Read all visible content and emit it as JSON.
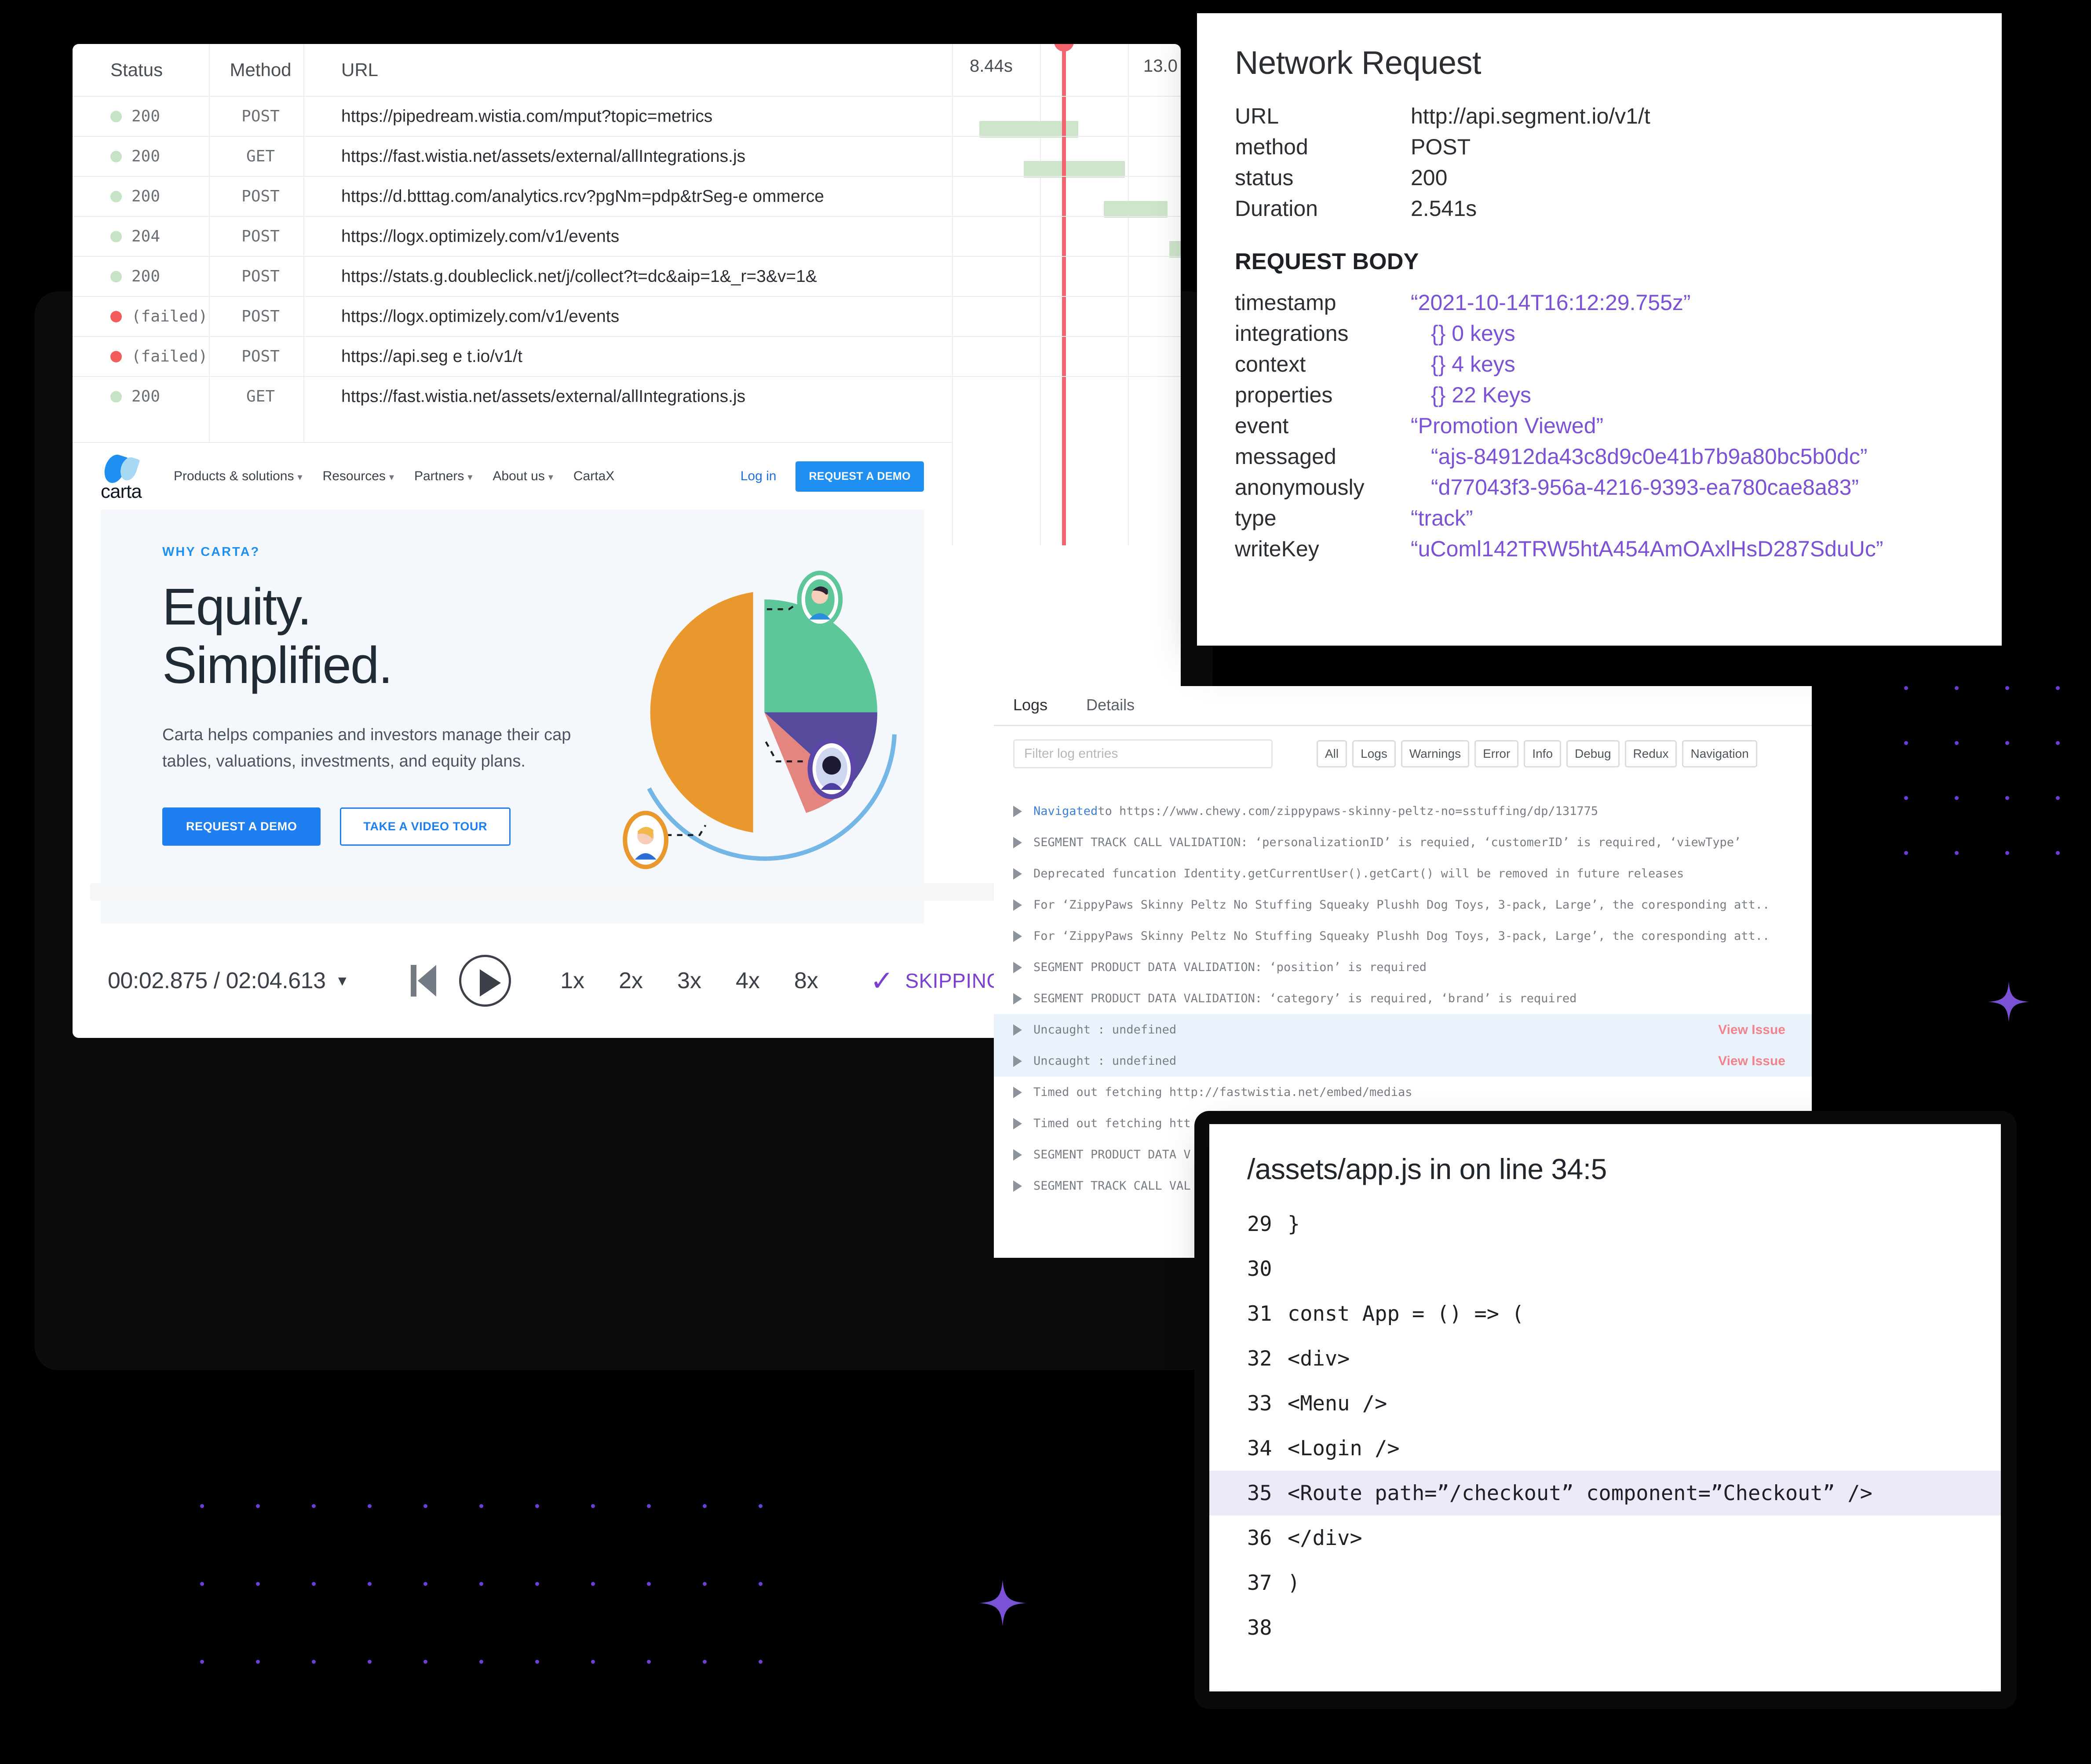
{
  "network_request_card": {
    "title": "Network Request",
    "meta": [
      {
        "key": "URL",
        "value": "http://api.segment.io/v1/t"
      },
      {
        "key": "method",
        "value": "POST"
      },
      {
        "key": "status",
        "value": "200"
      },
      {
        "key": "Duration",
        "value": "2.541s"
      }
    ],
    "section_title": "REQUEST BODY",
    "body": [
      {
        "key": "timestamp",
        "value": "“2021-10-14T16:12:29.755z”"
      },
      {
        "key": "integrations",
        "value": "{} 0 keys"
      },
      {
        "key": "context",
        "value": "{} 4 keys"
      },
      {
        "key": "properties",
        "value": "{} 22 Keys"
      },
      {
        "key": "event",
        "value": "“Promotion Viewed”"
      },
      {
        "key": "messaged",
        "value": "“ajs-84912da43c8d9c0e41b7b9a80bc5b0dc”"
      },
      {
        "key": "anonymously",
        "value": "“d77043f3-956a-4216-9393-ea780cae8a83”"
      },
      {
        "key": "type",
        "value": "“track”"
      },
      {
        "key": "writeKey",
        "value": "“uComl142TRW5htA454AmOAxlHsD287SduUc”"
      }
    ],
    "accent_color": "#7b52d6"
  },
  "network_table": {
    "columns": {
      "status": "Status",
      "method": "Method",
      "url": "URL"
    },
    "rows": [
      {
        "status": "200",
        "ok": true,
        "method": "POST",
        "url": "https://pipedream.wistia.com/mput?topic=metrics"
      },
      {
        "status": "200",
        "ok": true,
        "method": "GET",
        "url": "https://fast.wistia.net/assets/external/allIntegrations.js"
      },
      {
        "status": "200",
        "ok": true,
        "method": "POST",
        "url": "https://d.btttag.com/analytics.rcv?pgNm=pdp&trSeg-e  ommerce"
      },
      {
        "status": "204",
        "ok": true,
        "method": "POST",
        "url": "https://logx.optimizely.com/v1/events"
      },
      {
        "status": "200",
        "ok": true,
        "method": "POST",
        "url": "https://stats.g.doubleclick.net/j/collect?t=dc&aip=1&_r=3&v=1&"
      },
      {
        "status": "(failed)",
        "ok": false,
        "method": "POST",
        "url": "https://logx.optimizely.com/v1/events"
      },
      {
        "status": "(failed)",
        "ok": false,
        "method": "POST",
        "url": "https://api.seg e t.io/v1/t"
      },
      {
        "status": "200",
        "ok": true,
        "method": "GET",
        "url": "https://fast.wistia.net/assets/external/allIntegrations.js"
      }
    ]
  },
  "waterfall": {
    "tick_labels": [
      "8.44s",
      "13.0"
    ],
    "playhead_color": "#f4646e",
    "bar_color_ok": "#cee5cb",
    "bar_color_error": "#e4b4b4"
  },
  "carta_site": {
    "logo_text": "carta",
    "nav": [
      {
        "label": "Products & solutions",
        "caret": true
      },
      {
        "label": "Resources",
        "caret": true
      },
      {
        "label": "Partners",
        "caret": true
      },
      {
        "label": "About us",
        "caret": true
      },
      {
        "label": "CartaX",
        "caret": false
      }
    ],
    "login": "Log in",
    "demo_button": "REQUEST A DEMO",
    "hero": {
      "kicker": "WHY CARTA?",
      "heading_line1": "Equity.",
      "heading_line2": "Simplified.",
      "subtext": "Carta helps companies and investors manage their cap tables, valuations, investments, and equity plans.",
      "primary_button": "REQUEST A DEMO",
      "secondary_button": "TAKE A VIDEO TOUR"
    },
    "brand_blue": "#1f8ff2"
  },
  "player": {
    "current_time": "00:02.875",
    "total_time": "02:04.613",
    "time_display": "00:02.875 / 02:04.613",
    "speeds": [
      "1x",
      "2x",
      "3x",
      "4x",
      "8x"
    ],
    "skip_label": "SKIPPING INAC",
    "skip_color": "#7b3fd1"
  },
  "log_panel": {
    "tabs": [
      {
        "label": "Logs",
        "active": true
      },
      {
        "label": "Details",
        "active": false
      }
    ],
    "filter_placeholder": "Filter log entries",
    "chips": [
      "All",
      "Logs",
      "Warnings",
      "Error",
      "Info",
      "Debug",
      "Redux",
      "Navigation"
    ],
    "entries": [
      {
        "prefix": "Navigated",
        "text": " to https://www.chewy.com/zippypaws-skinny-peltz-no=sstuffing/dp/131775",
        "highlight": false,
        "action": ""
      },
      {
        "prefix": "",
        "text": "SEGMENT TRACK CALL VALIDATION: ‘personalizationID’ is requied, ‘customerID’ is required, ‘viewType’",
        "highlight": false,
        "action": ""
      },
      {
        "prefix": "",
        "text": "Deprecated funcation Identity.getCurrentUser().getCart() will be removed in future releases",
        "highlight": false,
        "action": ""
      },
      {
        "prefix": "",
        "text": "For ‘ZippyPaws Skinny Peltz No Stuffing Squeaky Plushh Dog Toys, 3-pack, Large’, the coresponding att..",
        "highlight": false,
        "action": ""
      },
      {
        "prefix": "",
        "text": "For ‘ZippyPaws Skinny Peltz No Stuffing Squeaky Plushh Dog Toys, 3-pack, Large’, the coresponding att..",
        "highlight": false,
        "action": ""
      },
      {
        "prefix": "",
        "text": "SEGMENT PRODUCT DATA VALIDATION: ‘position’ is required",
        "highlight": false,
        "action": ""
      },
      {
        "prefix": "",
        "text": "SEGMENT PRODUCT DATA VALIDATION: ‘category’ is required, ‘brand’ is required",
        "highlight": false,
        "action": ""
      },
      {
        "prefix": "",
        "text": "Uncaught : undefined",
        "highlight": true,
        "action": "View Issue"
      },
      {
        "prefix": "",
        "text": "Uncaught : undefined",
        "highlight": true,
        "action": "View Issue"
      },
      {
        "prefix": "",
        "text": "Timed out fetching http://fastwistia.net/embed/medias",
        "highlight": false,
        "action": ""
      },
      {
        "prefix": "",
        "text": "Timed out fetching htt",
        "highlight": false,
        "action": ""
      },
      {
        "prefix": "",
        "text": "SEGMENT PRODUCT DATA V",
        "highlight": false,
        "action": ""
      },
      {
        "prefix": "",
        "text": "SEGMENT TRACK CALL VAL",
        "highlight": false,
        "action": ""
      }
    ],
    "action_color": "#f4828d"
  },
  "code_card": {
    "title": "/assets/app.js in on line 34:5",
    "lines": [
      {
        "no": "29",
        "code": "}",
        "highlight": false
      },
      {
        "no": "30",
        "code": "",
        "highlight": false
      },
      {
        "no": "31",
        "code": "const App = () => (",
        "highlight": false
      },
      {
        "no": "32",
        "code": "<div>",
        "highlight": false
      },
      {
        "no": "33",
        "code": "<Menu />",
        "highlight": false
      },
      {
        "no": "34",
        "code": "<Login />",
        "highlight": false
      },
      {
        "no": "35",
        "code": "<Route path=”/checkout” component=”Checkout” />",
        "highlight": true
      },
      {
        "no": "36",
        "code": "</div>",
        "highlight": false
      },
      {
        "no": "37",
        "code": ")",
        "highlight": false
      },
      {
        "no": "38",
        "code": "",
        "highlight": false
      }
    ],
    "highlight_color": "#eceaf8"
  }
}
